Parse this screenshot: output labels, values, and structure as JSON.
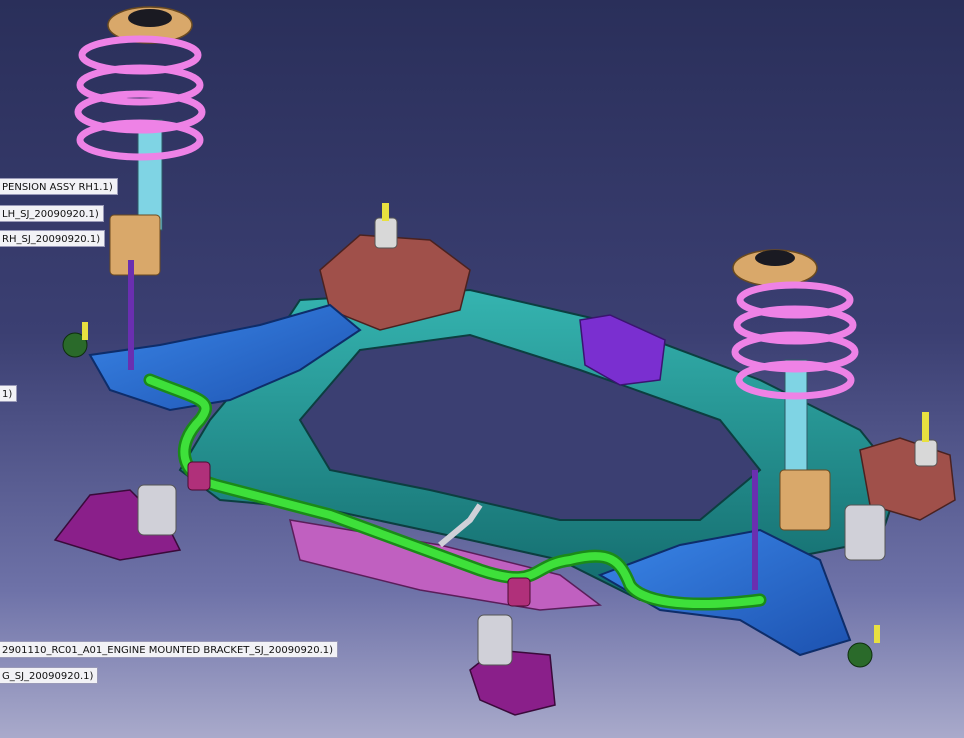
{
  "app": {
    "name": "CAD 3D viewport"
  },
  "tree_labels": [
    {
      "text": "PENSION ASSY RH1.1)"
    },
    {
      "text": "LH_SJ_20090920.1)"
    },
    {
      "text": "RH_SJ_20090920.1)"
    },
    {
      "text": "1)"
    },
    {
      "text": "2901110_RC01_A01_ENGINE MOUNTED BRACKET_SJ_20090920.1)"
    },
    {
      "text": "G_SJ_20090920.1)"
    }
  ],
  "colors": {
    "background_top": "#2a2f5a",
    "background_bottom": "#a9aacb",
    "subframe": "#1f8a8a",
    "control_arm": "#2a6fd6",
    "stabilizer_bar": "#3ee03a",
    "coil_spring": "#ee82e6",
    "strut_mount": "#d9a86a",
    "engine_mount": "#a0504a",
    "bracket": "#7a2fd0"
  }
}
